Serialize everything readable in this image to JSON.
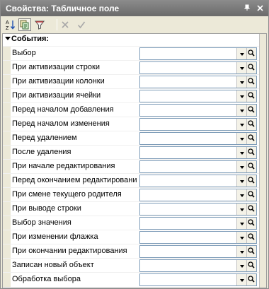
{
  "window": {
    "title": "Свойства: Табличное поле"
  },
  "titlebar": {
    "pin_icon": "pin-icon",
    "close_icon": "close-icon"
  },
  "toolbar": {
    "items": [
      {
        "icon": "sort-alphabetical-icon"
      },
      {
        "icon": "categorized-view-icon"
      },
      {
        "icon": "filter-icon"
      },
      {
        "icon": "delete-x-icon"
      },
      {
        "icon": "checkmark-icon"
      }
    ]
  },
  "section": {
    "label": "События:"
  },
  "events": [
    {
      "label": "Выбор",
      "value": ""
    },
    {
      "label": "При активизации строки",
      "value": ""
    },
    {
      "label": "При активизации колонки",
      "value": ""
    },
    {
      "label": "При активизации ячейки",
      "value": ""
    },
    {
      "label": "Перед началом добавления",
      "value": ""
    },
    {
      "label": "Перед началом изменения",
      "value": ""
    },
    {
      "label": "Перед удалением",
      "value": ""
    },
    {
      "label": "После удаления",
      "value": ""
    },
    {
      "label": "При начале редактирования",
      "value": ""
    },
    {
      "label": "Перед окончанием редактировани",
      "value": ""
    },
    {
      "label": "При смене текущего родителя",
      "value": ""
    },
    {
      "label": "При выводе строки",
      "value": ""
    },
    {
      "label": "Выбор значения",
      "value": ""
    },
    {
      "label": "При изменении флажка",
      "value": ""
    },
    {
      "label": "При окончании редактирования",
      "value": ""
    },
    {
      "label": "Записан новый объект",
      "value": ""
    },
    {
      "label": "Обработка выбора",
      "value": ""
    }
  ]
}
